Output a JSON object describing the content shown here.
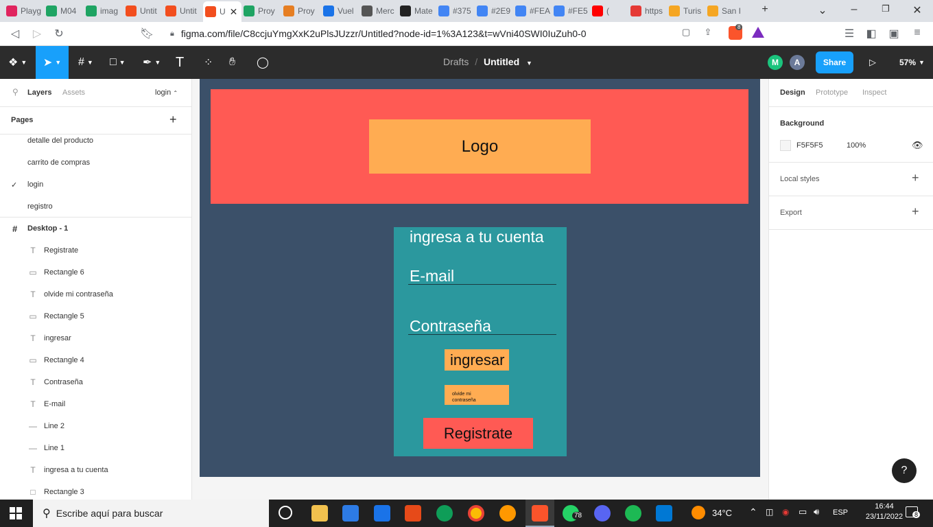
{
  "browser": {
    "tabs": [
      {
        "label": "Playg",
        "color": "#e0245e"
      },
      {
        "label": "M04",
        "color": "#1fa463"
      },
      {
        "label": "imag",
        "color": "#1fa463"
      },
      {
        "label": "Untit",
        "color": "#f24e1e"
      },
      {
        "label": "Untit",
        "color": "#f24e1e"
      },
      {
        "label": "U",
        "color": "#f24e1e"
      },
      {
        "label": "Proy",
        "color": "#1fa463"
      },
      {
        "label": "Proy",
        "color": "#e67e22"
      },
      {
        "label": "Vuel",
        "color": "#1a73e8"
      },
      {
        "label": "Merc",
        "color": "#555555"
      },
      {
        "label": "Mate",
        "color": "#222222"
      },
      {
        "label": "#375",
        "color": "#4285f4"
      },
      {
        "label": "#2E9",
        "color": "#4285f4"
      },
      {
        "label": "#FEA",
        "color": "#4285f4"
      },
      {
        "label": "#FE5",
        "color": "#4285f4"
      },
      {
        "label": "(",
        "color": "#ff0000"
      },
      {
        "label": "https",
        "color": "#e53935"
      },
      {
        "label": "Turis",
        "color": "#f5a623"
      },
      {
        "label": "San I",
        "color": "#f5a623"
      }
    ],
    "url": "figma.com/file/C8ccjuYmgXxK2uPlsJUzzr/Untitled?node-id=1%3A123&t=wVni40SWI0IuZuh0-0",
    "brave_badge": "8"
  },
  "figma": {
    "breadcrumb_root": "Drafts",
    "breadcrumb_sep": "/",
    "file_name": "Untitled",
    "avatars": [
      {
        "initial": "M",
        "color": "#1bc47d"
      },
      {
        "initial": "A",
        "color": "#6b7a99"
      }
    ],
    "share_label": "Share",
    "zoom": "57%"
  },
  "left_panel": {
    "tab_layers": "Layers",
    "tab_assets": "Assets",
    "current_page": "login",
    "pages_title": "Pages",
    "pages": [
      "detalle del producto",
      "carrito de compras",
      "login",
      "registro"
    ],
    "frame_name": "Desktop - 1",
    "layers": [
      {
        "name": "Registrate",
        "icon": "T"
      },
      {
        "name": "Rectangle 6",
        "icon": "▭"
      },
      {
        "name": "olvide mi contraseña",
        "icon": "T"
      },
      {
        "name": "Rectangle 5",
        "icon": "▭"
      },
      {
        "name": "ingresar",
        "icon": "T"
      },
      {
        "name": "Rectangle 4",
        "icon": "▭"
      },
      {
        "name": "Contraseña",
        "icon": "T"
      },
      {
        "name": "E-mail",
        "icon": "T"
      },
      {
        "name": "Line 2",
        "icon": "—"
      },
      {
        "name": "Line 1",
        "icon": "—"
      },
      {
        "name": "ingresa a tu cuenta",
        "icon": "T"
      },
      {
        "name": "Rectangle 3",
        "icon": "□"
      }
    ]
  },
  "design": {
    "logo": "Logo",
    "card_title": "ingresa a tu cuenta",
    "email_label": "E-mail",
    "password_label": "Contraseña",
    "ingresar": "ingresar",
    "olvide": "olvide mi contraseña",
    "registrate": "Registrate"
  },
  "right_panel": {
    "tabs": [
      "Design",
      "Prototype",
      "Inspect"
    ],
    "background_title": "Background",
    "bg_hex": "F5F5F5",
    "bg_opacity": "100%",
    "local_styles": "Local styles",
    "export": "Export"
  },
  "taskbar": {
    "search_placeholder": "Escribe aquí para buscar",
    "whatsapp_badge": "78",
    "weather": "34°C",
    "language": "ESP",
    "time": "16:44",
    "date": "23/11/2022",
    "notif_count": "8"
  }
}
